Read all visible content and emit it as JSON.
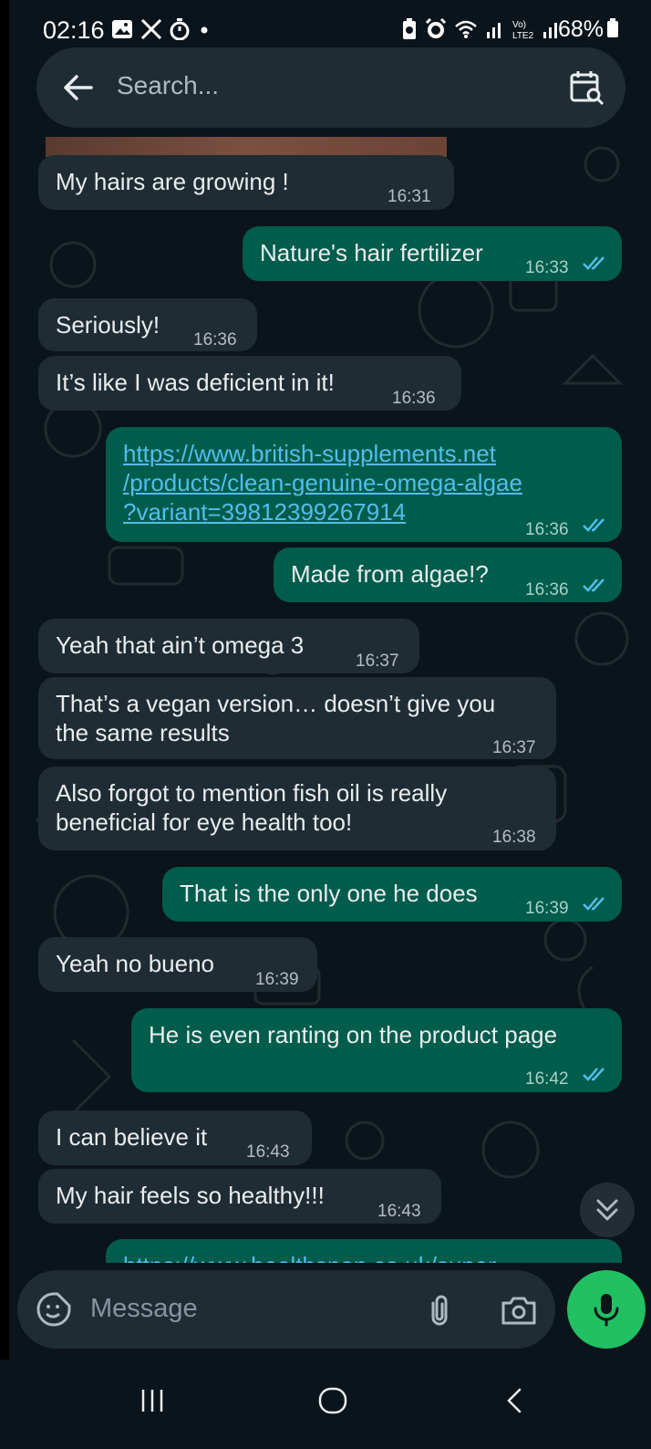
{
  "status_bar": {
    "time": "02:16",
    "battery": "68%",
    "left_icons": [
      "gallery-icon",
      "x-icon",
      "timer-icon",
      "dot-icon"
    ],
    "right_icons": [
      "battery-saver-icon",
      "alarm-icon",
      "wifi-icon",
      "signal-icon",
      "volte-icon",
      "signal-icon-2",
      "battery-icon"
    ],
    "network_label": "Vo)\nLTE2"
  },
  "search": {
    "placeholder": "Search..."
  },
  "messages": [
    {
      "dir": "in",
      "text": "My hairs are growing !",
      "time": "16:31"
    },
    {
      "dir": "out",
      "text": "Nature's hair fertilizer",
      "time": "16:33"
    },
    {
      "dir": "in",
      "text": "Seriously!",
      "time": "16:36"
    },
    {
      "dir": "in",
      "text": "It’s like I was deficient in it!",
      "time": "16:36"
    },
    {
      "dir": "out",
      "link": true,
      "text": "https://www.british-supplements.net\n/products/clean-genuine-omega-algae\n?variant=39812399267914",
      "time": "16:36"
    },
    {
      "dir": "out",
      "text": "Made from algae!?",
      "time": "16:36"
    },
    {
      "dir": "in",
      "text": "Yeah that ain’t omega 3",
      "time": "16:37"
    },
    {
      "dir": "in",
      "text": "That’s a vegan version… doesn’t give you\nthe same results",
      "time": "16:37"
    },
    {
      "dir": "in",
      "text": "Also forgot to mention fish oil is really\nbeneficial for eye health too!",
      "time": "16:38"
    },
    {
      "dir": "out",
      "text": "That is the only one he does",
      "time": "16:39"
    },
    {
      "dir": "in",
      "text": "Yeah no bueno",
      "time": "16:39"
    },
    {
      "dir": "out",
      "text": "He is even ranting on the product page",
      "time": "16:42"
    },
    {
      "dir": "in",
      "text": "I can believe it",
      "time": "16:43"
    },
    {
      "dir": "in",
      "text": "My hair feels so healthy!!!",
      "time": "16:43"
    },
    {
      "dir": "out",
      "link": true,
      "text": "https://www.healthspan.co.uk/super",
      "time": ""
    }
  ],
  "composer": {
    "placeholder": "Message"
  },
  "colors": {
    "background": "#0b141a",
    "incoming_bubble": "#202c33",
    "outgoing_bubble": "#005c4b",
    "link": "#53bdeb",
    "read_ticks": "#53bdeb",
    "mic_button": "#21c063"
  },
  "icons": {
    "back": "back-arrow-icon",
    "calendar_search": "calendar-search-icon",
    "emoji": "sticker-emoji-icon",
    "attach": "paperclip-icon",
    "camera": "camera-icon",
    "mic": "mic-icon",
    "scroll_down": "double-chevron-down-icon",
    "nav_recent": "recent-apps-icon",
    "nav_home": "home-icon",
    "nav_back": "back-chevron-icon"
  }
}
